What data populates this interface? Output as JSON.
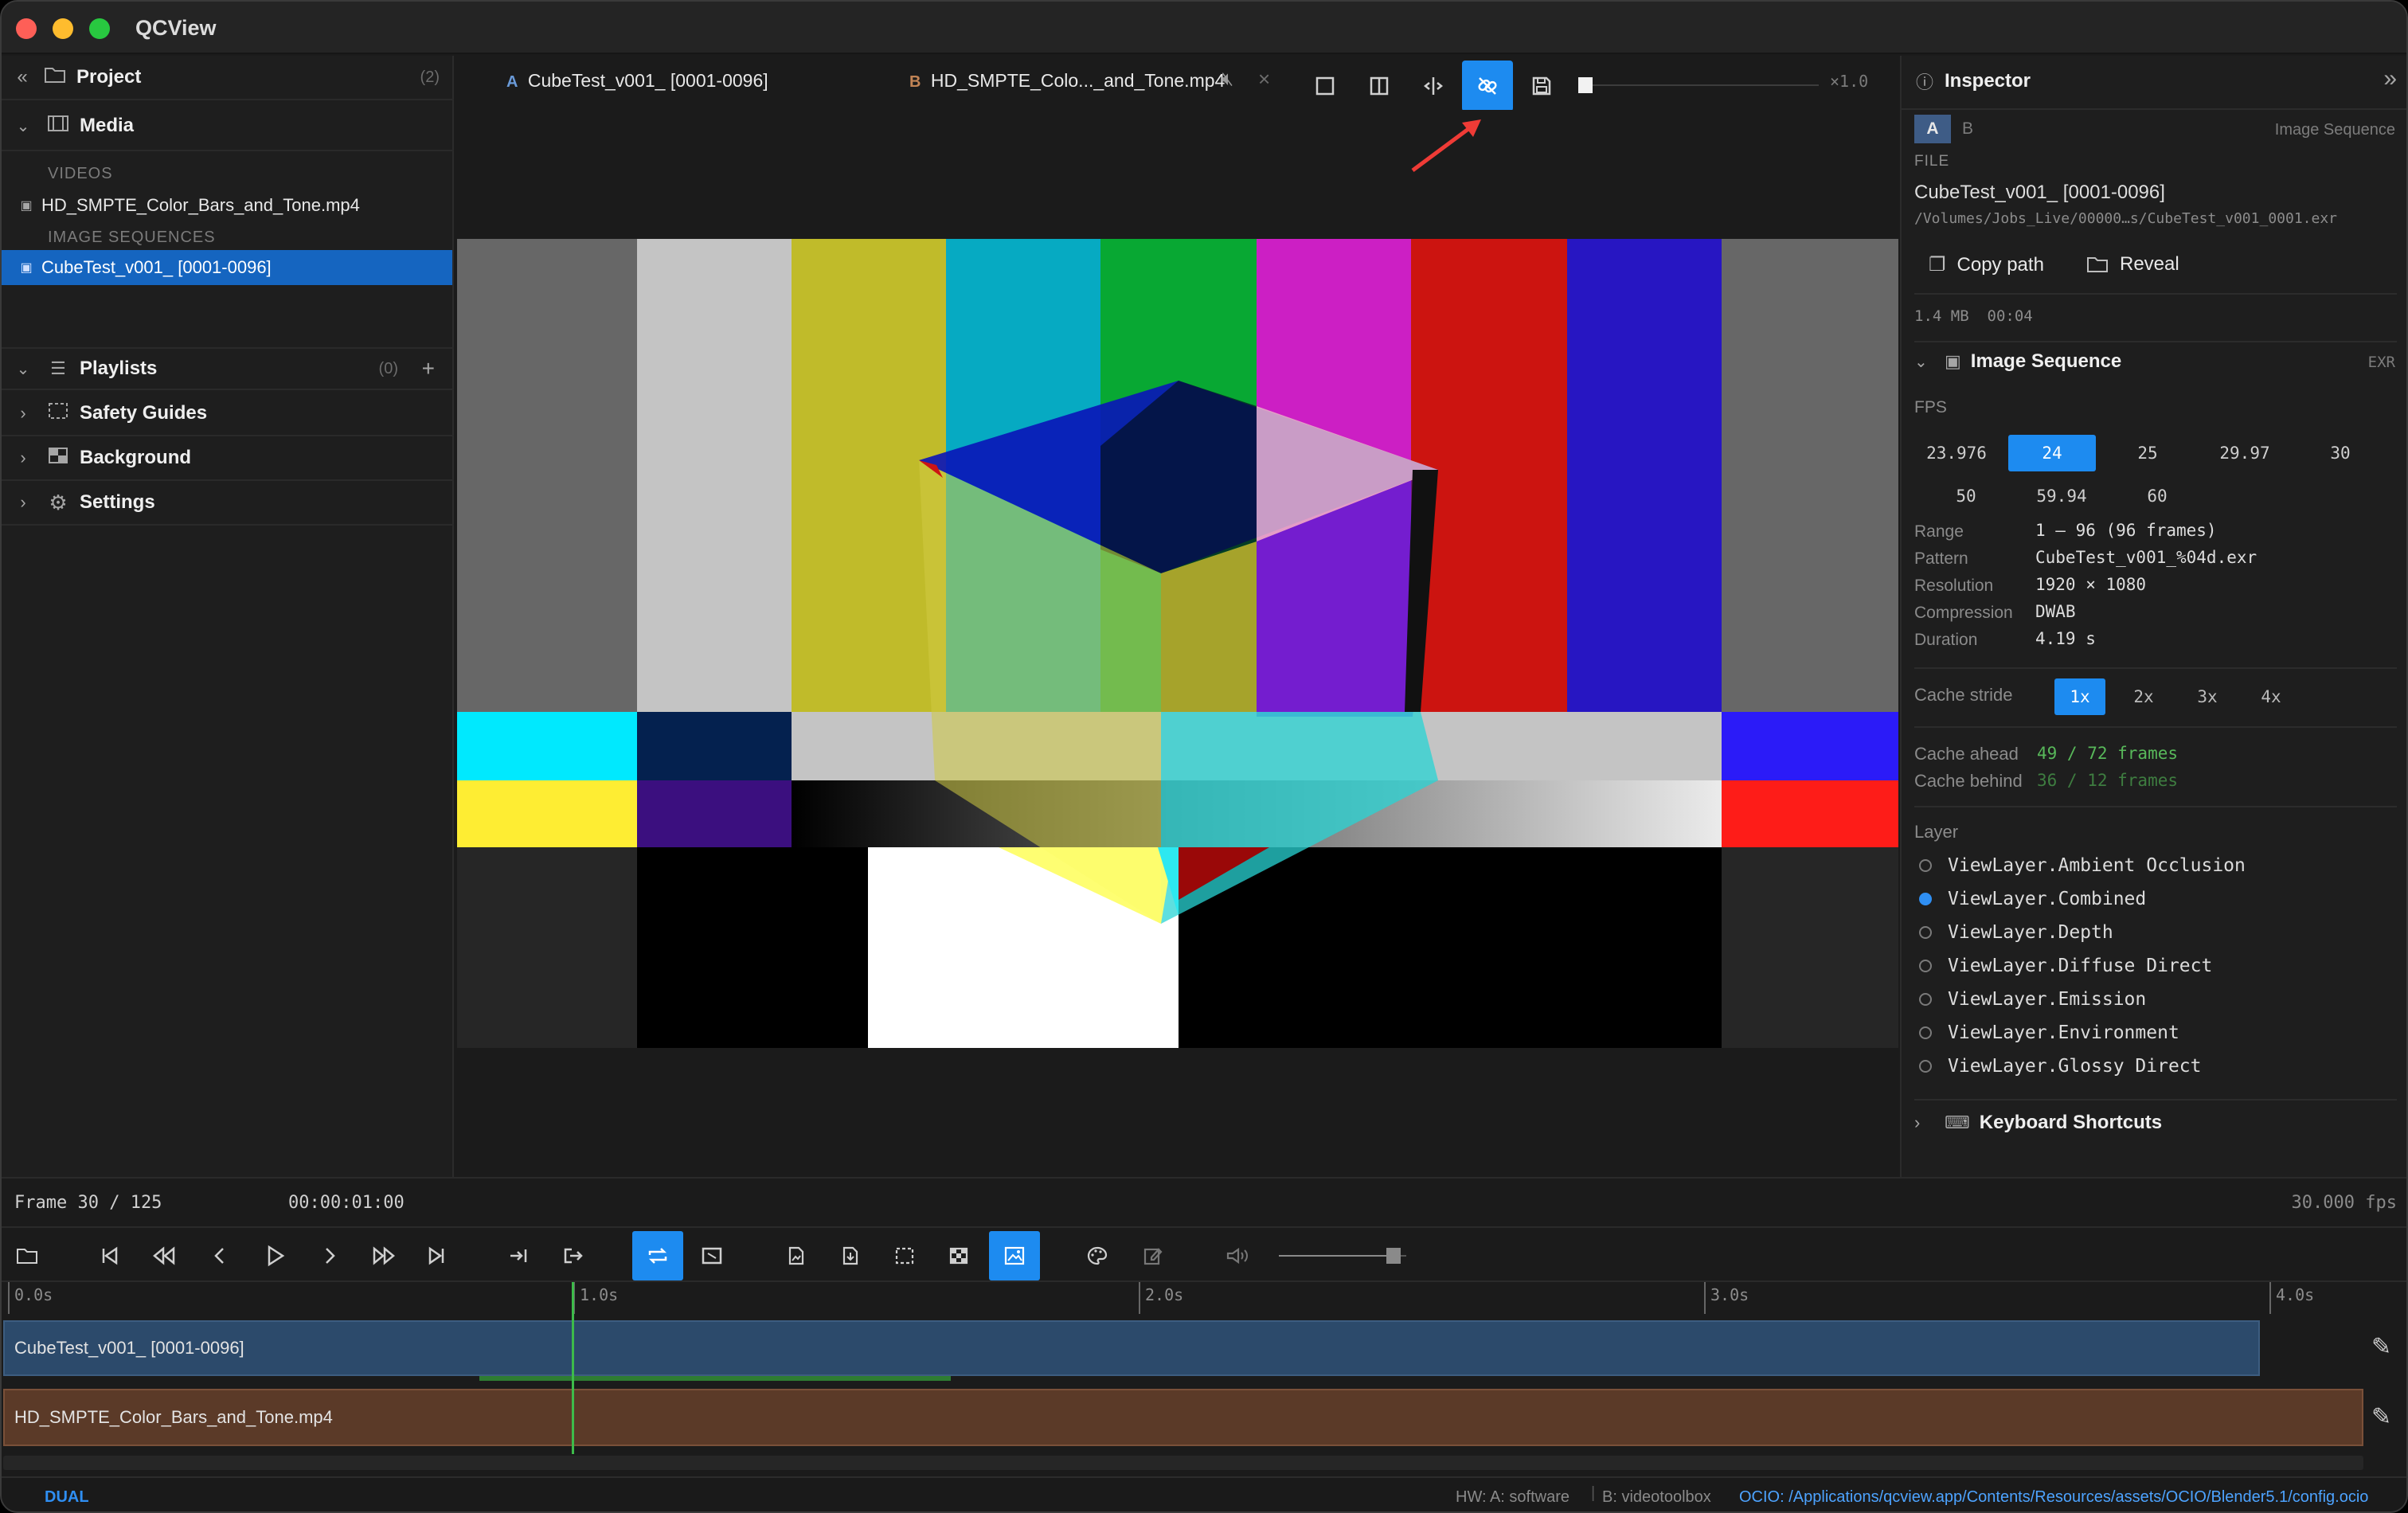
{
  "app": {
    "title": "QCView"
  },
  "sidebar": {
    "project_label": "Project",
    "project_count": "(2)",
    "media_label": "Media",
    "videos_group": "VIDEOS",
    "video_item": "HD_SMPTE_Color_Bars_and_Tone.mp4",
    "sequences_group": "IMAGE SEQUENCES",
    "sequence_item": "CubeTest_v001_ [0001-0096]",
    "playlists_label": "Playlists",
    "playlists_count": "(0)",
    "safety_label": "Safety Guides",
    "background_label": "Background",
    "settings_label": "Settings"
  },
  "tabs": {
    "a_letter": "A",
    "a_name": "CubeTest_v001_ [0001-0096]",
    "b_letter": "B",
    "b_name": "HD_SMPTE_Colo..._and_Tone.mp4",
    "speed": "×1.0"
  },
  "inspector": {
    "title": "Inspector",
    "ab_a": "A",
    "ab_b": "B",
    "type": "Image Sequence",
    "file_label": "FILE",
    "file_name": "CubeTest_v001_ [0001-0096]",
    "file_path": "/Volumes/Jobs_Live/00000…s/CubeTest_v001_0001.exr",
    "copy_path": "Copy path",
    "reveal": "Reveal",
    "size": "1.4 MB",
    "duration_short": "00:04",
    "section": "Image Sequence",
    "section_badge": "EXR",
    "fps_label": "FPS",
    "fps_options": [
      "23.976",
      "24",
      "25",
      "29.97",
      "30",
      "50",
      "59.94",
      "60"
    ],
    "fps_selected": "24",
    "props": [
      {
        "k": "Range",
        "v": "1 – 96 (96 frames)"
      },
      {
        "k": "Pattern",
        "v": "CubeTest_v001_%04d.exr"
      },
      {
        "k": "Resolution",
        "v": "1920 × 1080"
      },
      {
        "k": "Compression",
        "v": "DWAB"
      },
      {
        "k": "Duration",
        "v": "4.19 s"
      }
    ],
    "stride_label": "Cache stride",
    "stride_options": [
      "1x",
      "2x",
      "3x",
      "4x"
    ],
    "stride_selected": "1x",
    "cache_ahead_label": "Cache ahead",
    "cache_ahead": "49 / 72 frames",
    "cache_behind_label": "Cache behind",
    "cache_behind": "36 / 12 frames",
    "layer_label": "Layer",
    "layers": [
      "ViewLayer.Ambient Occlusion",
      "ViewLayer.Combined",
      "ViewLayer.Depth",
      "ViewLayer.Diffuse Direct",
      "ViewLayer.Emission",
      "ViewLayer.Environment",
      "ViewLayer.Glossy Direct"
    ],
    "layer_selected": "ViewLayer.Combined",
    "shortcuts": "Keyboard Shortcuts"
  },
  "status": {
    "frame": "Frame 30 / 125",
    "timecode": "00:00:01:00",
    "fps": "30.000 fps"
  },
  "timeline": {
    "ticks": [
      "0.0s",
      "1.0s",
      "2.0s",
      "3.0s",
      "4.0s"
    ],
    "track_a": "CubeTest_v001_ [0001-0096]",
    "track_b": "HD_SMPTE_Color_Bars_and_Tone.mp4",
    "volume": 0.9,
    "playhead_seconds": 1.0
  },
  "footer": {
    "mode": "DUAL",
    "hw": "HW: A: software",
    "hw_b": "B: videotoolbox",
    "ocio": "OCIO: /Applications/qcview.app/Contents/Resources/assets/OCIO/Blender5.1/config.ocio"
  },
  "colors": {
    "accent": "#1d8bf0",
    "selection": "#1565c0",
    "cache_green": "#58b85a"
  }
}
